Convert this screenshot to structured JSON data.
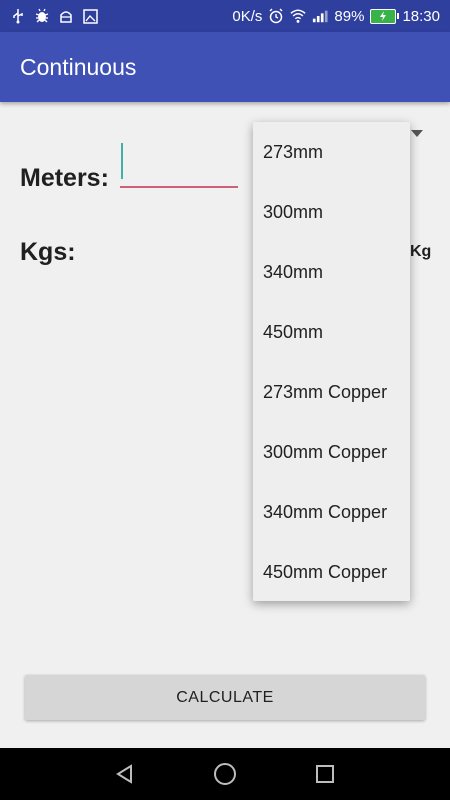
{
  "status_bar": {
    "left_icons": [
      "usb-icon",
      "debug-icon",
      "android-icon",
      "image-icon"
    ],
    "network_speed": "0K/s",
    "alarm_icon": "alarm-icon",
    "wifi_icon": "wifi-icon",
    "signal_icon": "signal-icon",
    "battery_percent": "89%",
    "battery_icon": "battery-charging-icon",
    "time": "18:30"
  },
  "app_bar": {
    "title": "Continuous",
    "color": "#3f51b5"
  },
  "form": {
    "meters_label": "Meters:",
    "meters_value": "",
    "kgs_label": "Kgs:",
    "kg_unit": "Kg",
    "underline_color": "#d0607a"
  },
  "dropdown": {
    "options": [
      "273mm",
      "300mm",
      "340mm",
      "450mm",
      "273mm Copper",
      "300mm Copper",
      "340mm Copper",
      "450mm Copper"
    ]
  },
  "calculate_button": {
    "label": "CALCULATE"
  },
  "nav_bar": {
    "buttons": [
      "back-icon",
      "home-icon",
      "recents-icon"
    ]
  }
}
